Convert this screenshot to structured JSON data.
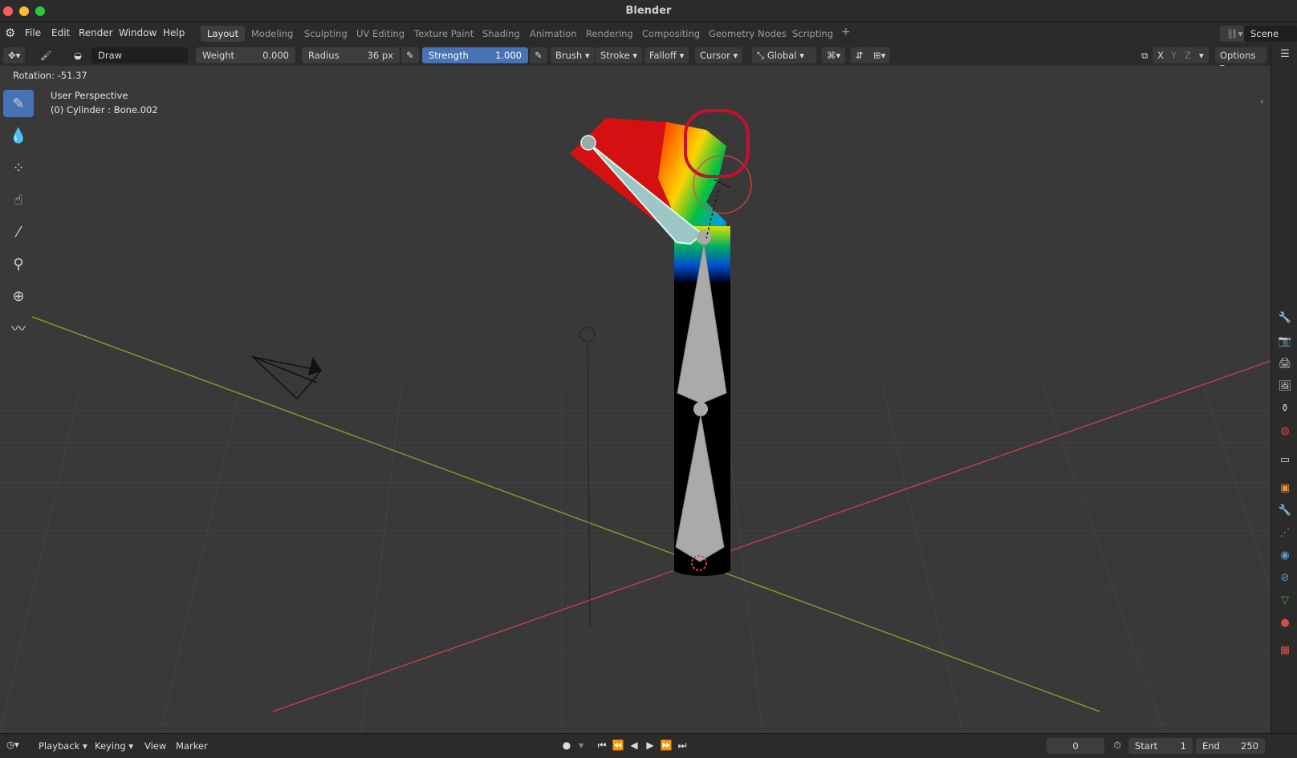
{
  "window": {
    "title": "Blender"
  },
  "menu": {
    "file": "File",
    "edit": "Edit",
    "render": "Render",
    "window": "Window",
    "help": "Help"
  },
  "workspaces": [
    "Layout",
    "Modeling",
    "Sculpting",
    "UV Editing",
    "Texture Paint",
    "Shading",
    "Animation",
    "Rendering",
    "Compositing",
    "Geometry Nodes",
    "Scripting"
  ],
  "scene": {
    "label": "Scene"
  },
  "header": {
    "brush_name": "Draw",
    "weight_label": "Weight",
    "weight_value": "0.000",
    "radius_label": "Radius",
    "radius_value": "36 px",
    "strength_label": "Strength",
    "strength_value": "1.000",
    "brush_dd": "Brush",
    "stroke_dd": "Stroke",
    "falloff_dd": "Falloff",
    "cursor_dd": "Cursor",
    "orientation_dd": "Global",
    "axis_x": "X",
    "axis_y": "Y",
    "axis_z": "Z",
    "options_dd": "Options"
  },
  "viewport": {
    "rotation": "Rotation: -51.37",
    "perspective": "User Perspective",
    "object_info": "(0) Cylinder : Bone.002"
  },
  "timeline": {
    "playback": "Playback",
    "keying": "Keying",
    "view": "View",
    "marker": "Marker",
    "current_frame": "0",
    "start_label": "Start",
    "start_value": "1",
    "end_label": "End",
    "end_value": "250"
  },
  "colors": {
    "accent": "#4772b3",
    "annotation": "#c8102e",
    "x_axis": "#b5424c",
    "y_axis": "#7a9a32"
  }
}
